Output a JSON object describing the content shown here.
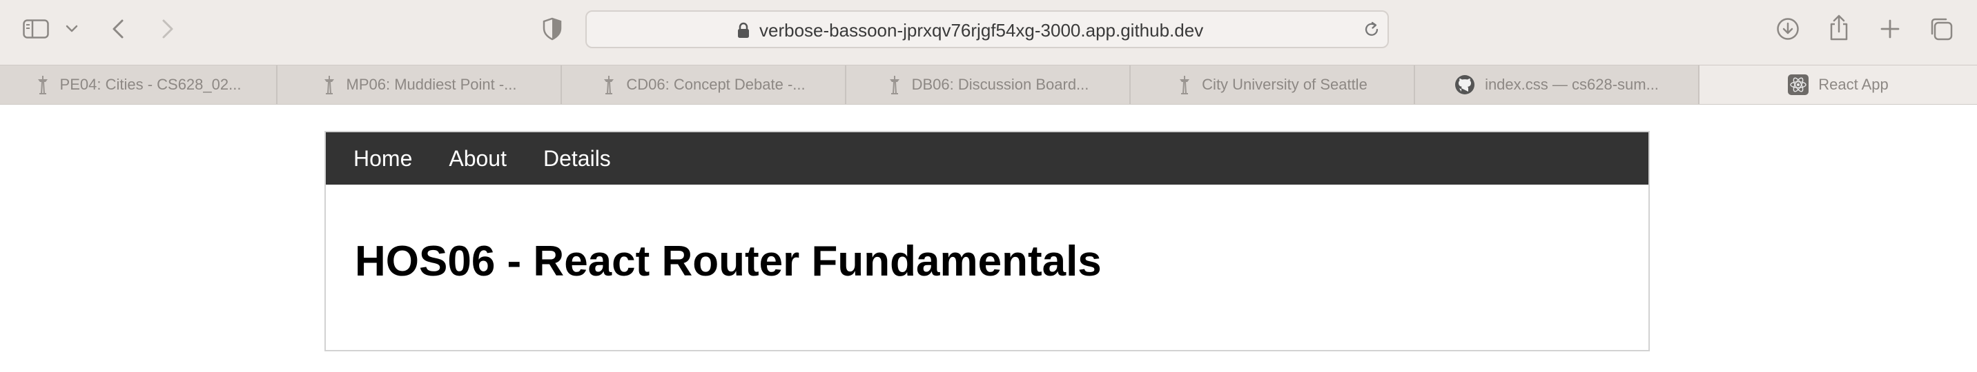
{
  "browser": {
    "url": "verbose-bassoon-jprxqv76rjgf54xg-3000.app.github.dev",
    "icons": [
      "sidebar-icon",
      "chevron-down-icon",
      "back-icon",
      "forward-icon",
      "shield-icon",
      "lock-icon",
      "reload-icon",
      "download-icon",
      "share-icon",
      "new-tab-icon",
      "tab-overview-icon"
    ],
    "tabs": [
      {
        "label": "PE04: Cities - CS628_02...",
        "icon": "seattle-icon"
      },
      {
        "label": "MP06: Muddiest Point -...",
        "icon": "seattle-icon"
      },
      {
        "label": "CD06: Concept Debate -...",
        "icon": "seattle-icon"
      },
      {
        "label": "DB06: Discussion Board...",
        "icon": "seattle-icon"
      },
      {
        "label": "City University of Seattle",
        "icon": "seattle-icon"
      },
      {
        "label": "index.css — cs628-sum...",
        "icon": "github-icon"
      },
      {
        "label": "React App",
        "icon": "react-icon"
      }
    ]
  },
  "nav": {
    "items": [
      "Home",
      "About",
      "Details"
    ]
  },
  "main": {
    "heading": "HOS06 - React Router Fundamentals"
  }
}
